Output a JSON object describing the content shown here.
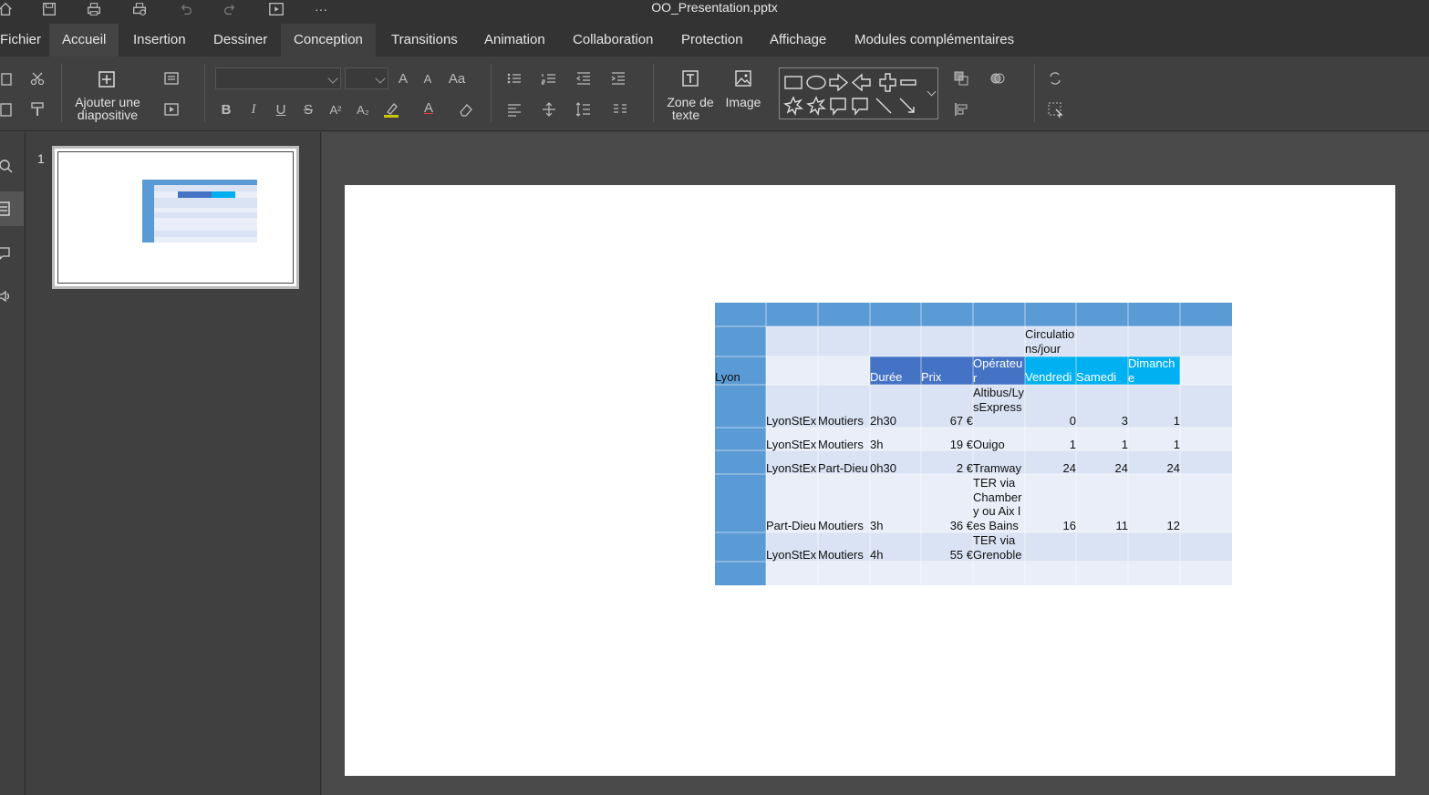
{
  "window": {
    "title": "OO_Presentation.pptx"
  },
  "quick_access": [
    {
      "name": "home-icon"
    },
    {
      "name": "save-icon"
    },
    {
      "name": "print-icon"
    },
    {
      "name": "quick-print-icon"
    },
    {
      "name": "undo-icon"
    },
    {
      "name": "redo-icon"
    },
    {
      "name": "slideshow-icon"
    },
    {
      "name": "more-icon",
      "label": "···"
    }
  ],
  "tabs": [
    {
      "label": "Fichier"
    },
    {
      "label": "Accueil"
    },
    {
      "label": "Insertion"
    },
    {
      "label": "Dessiner"
    },
    {
      "label": "Conception"
    },
    {
      "label": "Transitions"
    },
    {
      "label": "Animation"
    },
    {
      "label": "Collaboration"
    },
    {
      "label": "Protection"
    },
    {
      "label": "Affichage"
    },
    {
      "label": "Modules complémentaires"
    }
  ],
  "toolbar": {
    "add_slide_label_1": "Ajouter une",
    "add_slide_label_2": "diapositive",
    "textbox_label_1": "Zone de",
    "textbox_label_2": "texte",
    "image_label": "Image",
    "bold": "B",
    "italic": "I",
    "underline": "U",
    "strike": "S",
    "superscript": "A²",
    "subscript": "A₂",
    "font_color": "A",
    "grow_font": "A",
    "shrink_font": "A",
    "change_case": "Aa"
  },
  "thumbnails": [
    {
      "number": "1"
    }
  ],
  "colors": {
    "header_blue": "#5b9bd5",
    "col_header_dark": "#4472c4",
    "col_header_cyan": "#00b0f0",
    "row_light": "#dae3f3",
    "row_lighter": "#e9eef8"
  },
  "table": {
    "corner_label": "Lyon",
    "circulations_label": "Circulations/jour",
    "headers": {
      "duree": "Durée",
      "prix": "Prix",
      "operateur": "Opérateur",
      "vendredi": "Vendredi",
      "samedi": "Samedi",
      "dimanche": "Dimanche"
    },
    "rows": [
      {
        "from": "LyonStEx",
        "to": "Moutiers",
        "duree": "2h30",
        "prix": "67 €",
        "operateur": "Altibus/LysExpress",
        "vendredi": "0",
        "samedi": "3",
        "dimanche": "1"
      },
      {
        "from": "LyonStEx",
        "to": "Moutiers",
        "duree": "3h",
        "prix": "19 €",
        "operateur": "Ouigo",
        "vendredi": "1",
        "samedi": "1",
        "dimanche": "1"
      },
      {
        "from": "LyonStEx",
        "to": "Part-Dieu",
        "duree": "0h30",
        "prix": "2 €",
        "operateur": "Tramway",
        "vendredi": "24",
        "samedi": "24",
        "dimanche": "24"
      },
      {
        "from": "Part-Dieu",
        "to": "Moutiers",
        "duree": "3h",
        "prix": "36 €",
        "operateur": "TER via Chambery ou Aix les Bains",
        "vendredi": "16",
        "samedi": "11",
        "dimanche": "12"
      },
      {
        "from": "LyonStEx",
        "to": "Moutiers",
        "duree": "4h",
        "prix": "55 €",
        "operateur": "TER via Grenoble",
        "vendredi": "",
        "samedi": "",
        "dimanche": ""
      }
    ]
  }
}
